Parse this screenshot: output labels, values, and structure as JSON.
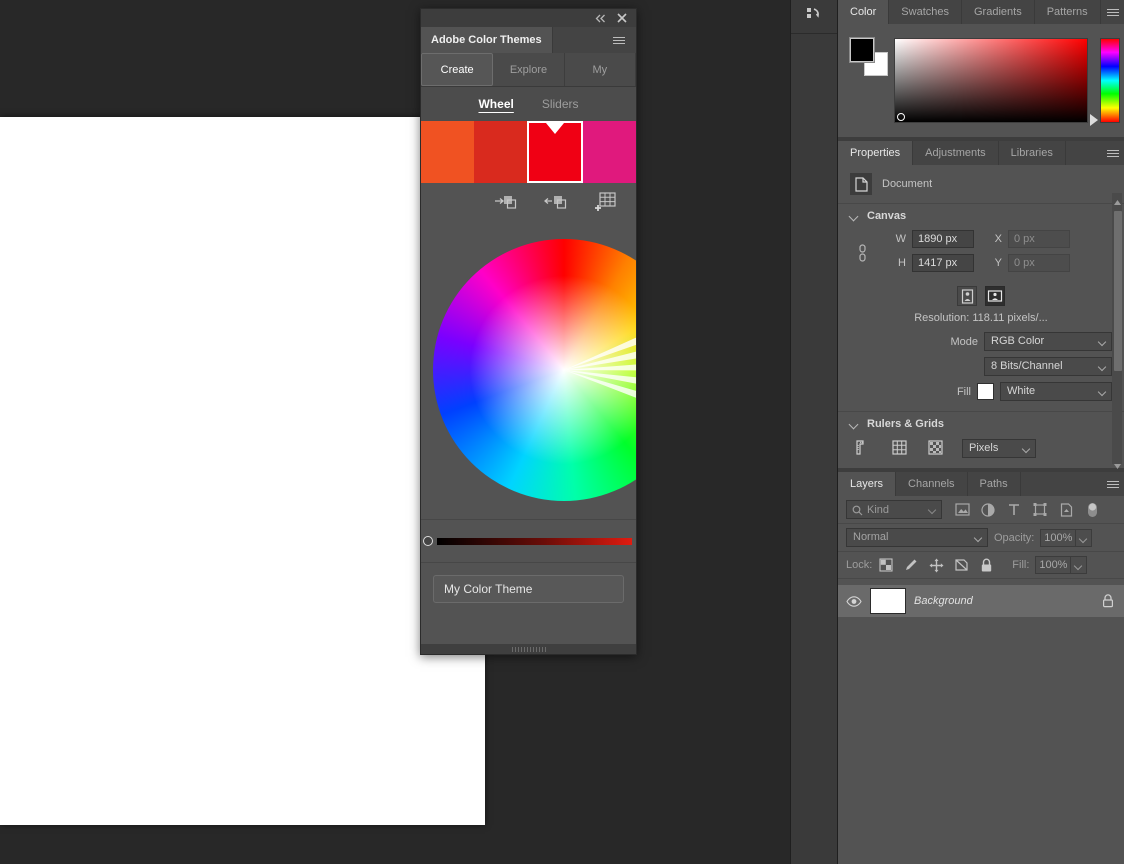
{
  "workspace": {
    "canvas_label": "document-canvas"
  },
  "dock": {
    "history_icon": "history-icon"
  },
  "color_panel": {
    "tabs": [
      {
        "label": "Color",
        "active": true
      },
      {
        "label": "Swatches",
        "active": false
      },
      {
        "label": "Gradients",
        "active": false
      },
      {
        "label": "Patterns",
        "active": false
      }
    ],
    "menu_icon": "panel-menu-icon",
    "foreground_color": "#000000",
    "background_color": "#ffffff",
    "picker_hue": "#ff0000"
  },
  "properties_panel": {
    "tabs": [
      {
        "label": "Properties",
        "active": true
      },
      {
        "label": "Adjustments",
        "active": false
      },
      {
        "label": "Libraries",
        "active": false
      }
    ],
    "menu_icon": "panel-menu-icon",
    "document_row_label": "Document",
    "canvas": {
      "section_title": "Canvas",
      "w_label": "W",
      "w_value": "1890 px",
      "h_label": "H",
      "h_value": "1417 px",
      "x_label": "X",
      "x_value": "0 px",
      "y_label": "Y",
      "y_value": "0 px",
      "resolution_text": "Resolution:  118.11  pixels/...",
      "mode_label": "Mode",
      "mode_value": "RGB Color",
      "depth_value": "8 Bits/Channel",
      "fill_label": "Fill",
      "fill_value": "White",
      "fill_color": "#ffffff"
    },
    "rulers_grids": {
      "section_title": "Rulers & Grids",
      "units_value": "Pixels"
    }
  },
  "layers_panel": {
    "tabs": [
      {
        "label": "Layers",
        "active": true
      },
      {
        "label": "Channels",
        "active": false
      },
      {
        "label": "Paths",
        "active": false
      }
    ],
    "menu_icon": "panel-menu-icon",
    "filter_kind": "Kind",
    "blend_mode": "Normal",
    "opacity_label": "Opacity:",
    "opacity_value": "100%",
    "lock_label": "Lock:",
    "fill_label": "Fill:",
    "fill_value": "100%",
    "layers": [
      {
        "name": "Background",
        "visible": true,
        "locked": true,
        "thumb_color": "#ffffff"
      }
    ]
  },
  "color_themes_panel": {
    "title": "Adobe Color Themes",
    "collapse_icon": "collapse-icon",
    "close_icon": "close-icon",
    "menu_icon": "panel-menu-icon",
    "tabs": [
      {
        "label": "Create",
        "active": true
      },
      {
        "label": "Explore",
        "active": false
      },
      {
        "label": "My",
        "active": false
      }
    ],
    "subtabs": [
      {
        "label": "Wheel",
        "active": true
      },
      {
        "label": "Sliders",
        "active": false
      }
    ],
    "swatches": [
      {
        "color": "#F05222",
        "selected": false
      },
      {
        "color": "#D92A1E",
        "selected": false
      },
      {
        "color": "#F00014",
        "selected": true
      },
      {
        "color": "#E0197D",
        "selected": false
      }
    ],
    "rule_icons": [
      "set-from-foreground-icon",
      "set-to-foreground-icon",
      "add-to-swatches-icon"
    ],
    "theme_name": "My Color Theme"
  }
}
